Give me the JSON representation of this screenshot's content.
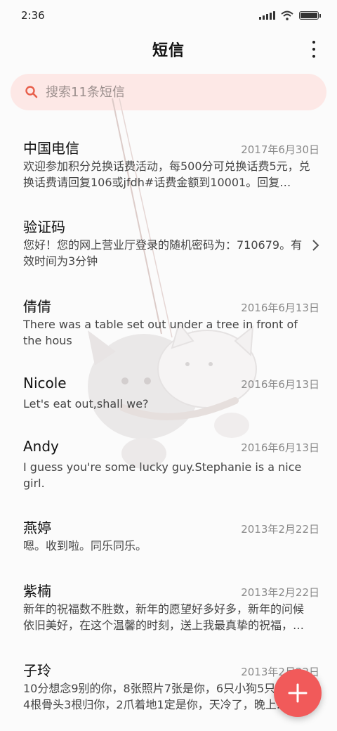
{
  "status_bar": {
    "time": "2:36",
    "icons": [
      "signal-icon",
      "wifi-icon",
      "battery-icon"
    ]
  },
  "header": {
    "title": "短信",
    "menu_icon": "more-vertical-icon"
  },
  "search": {
    "placeholder": "搜索11条短信",
    "icon": "search-icon"
  },
  "threads": [
    {
      "sender": "中国电信",
      "date": "2017年6月30日",
      "preview": "欢迎参加积分兑换话费活动，每500分可兑换话费5元，兑换话费请回复106或jfdh#话费金额到10001。回复…"
    },
    {
      "sender": "验证码",
      "date": "",
      "preview": "您好！您的网上营业厅登录的随机密码为：710679。有效时间为3分钟"
    },
    {
      "sender": "倩倩",
      "date": "2016年6月13日",
      "preview": "There was a table set out under a tree in front of the hous"
    },
    {
      "sender": "Nicole",
      "date": "2016年6月13日",
      "preview": "Let's eat out,shall we?"
    },
    {
      "sender": "Andy",
      "date": "2016年6月13日",
      "preview": "I guess you're some lucky guy.Stephanie is a nice girl."
    },
    {
      "sender": "燕婷",
      "date": "2013年2月22日",
      "preview": "嗯。收到啦。同乐同乐。"
    },
    {
      "sender": "紫楠",
      "date": "2013年2月22日",
      "preview": "新年的祝福数不胜数，新年的愿望好多好多，新年的问候依旧美好，在这个温馨的时刻，送上我最真挚的祝福，…"
    },
    {
      "sender": "子玲",
      "date": "2013年2月22日",
      "preview": "10分想念9别的你，8张照片7张是你，6只小狗5只像你，4根骨头3根归你，2爪着地1定是你，天冷了，晚上…"
    }
  ],
  "fab": {
    "icon": "plus-icon"
  },
  "colors": {
    "accent": "#f15a5a",
    "search_bg": "#fde8e6",
    "search_icon": "#e8604c"
  }
}
